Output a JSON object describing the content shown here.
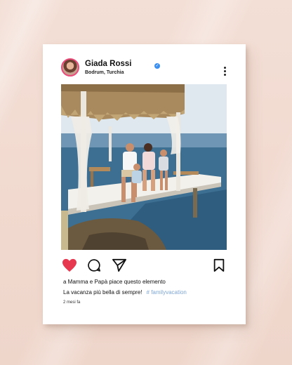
{
  "post": {
    "username": "Giada Rossi",
    "location": "Bodrum, Turchia",
    "likes_text": "a Mamma e Papà piace questo elemento",
    "caption": "La vacanza più bella di sempre!",
    "hashtag": "#  familyvacation",
    "time_ago": "2 mesi fa"
  },
  "icons": {
    "verified": "verified-badge-icon",
    "more": "more-vertical-icon",
    "like": "heart-icon",
    "comment": "comment-icon",
    "share": "send-icon",
    "save": "bookmark-icon"
  },
  "colors": {
    "like": "#e63950",
    "verified": "#3b8ff0",
    "hashtag": "#7fa7d6",
    "background": "#f1d9cf"
  }
}
